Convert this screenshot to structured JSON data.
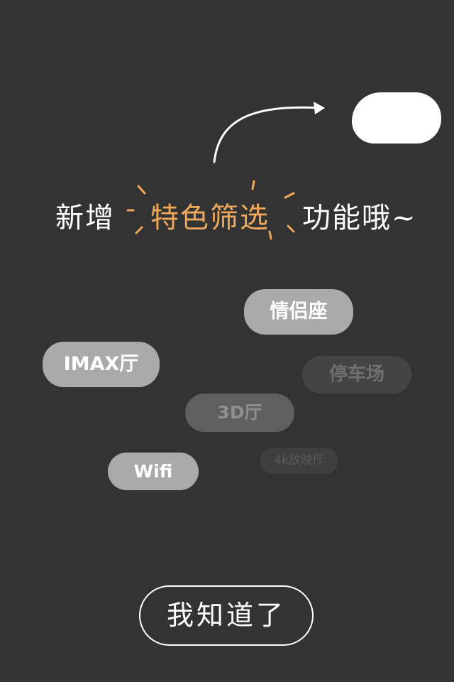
{
  "guide": {
    "headline_prefix": "新增",
    "headline_highlight": "特色筛选",
    "headline_suffix": "功能哦~"
  },
  "tags": {
    "lovers_seat": "情侣座",
    "imax_hall": "IMAX厅",
    "parking": "停车场",
    "hall_3d": "3D厅",
    "wifi": "Wifi",
    "hall_4k": "4k放映厅"
  },
  "actions": {
    "got_it": "我知道了"
  },
  "colors": {
    "background": "#333333",
    "accent": "#f0a85c",
    "tag_active": "#aaaaaa",
    "text": "#ffffff"
  }
}
